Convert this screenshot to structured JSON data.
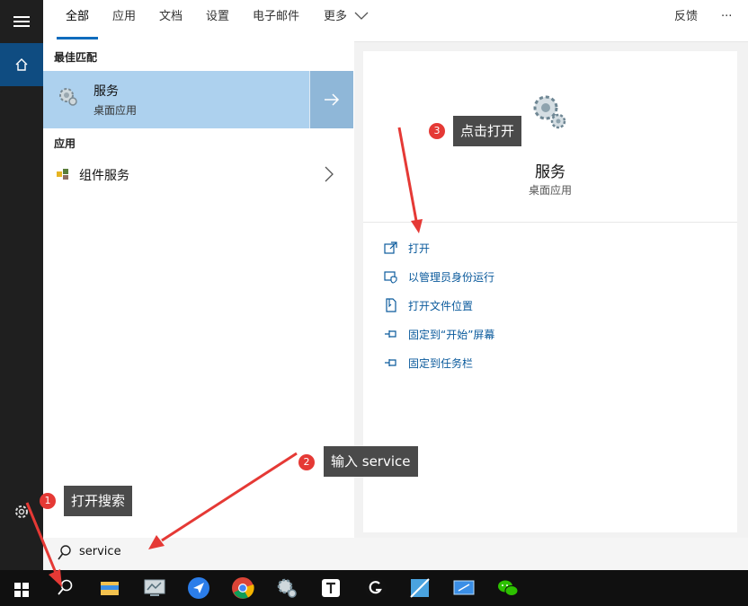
{
  "tabs": [
    "全部",
    "应用",
    "文档",
    "设置",
    "电子邮件",
    "更多"
  ],
  "feedback": "反馈",
  "more_menu": "···",
  "best_match": {
    "label": "最佳匹配",
    "title": "服务",
    "subtitle": "桌面应用"
  },
  "apps": {
    "label": "应用",
    "item": "组件服务"
  },
  "detail": {
    "title": "服务",
    "subtitle": "桌面应用",
    "actions": [
      "打开",
      "以管理员身份运行",
      "打开文件位置",
      "固定到“开始”屏幕",
      "固定到任务栏"
    ]
  },
  "search": {
    "value": "service"
  },
  "callouts": {
    "c1": {
      "num": "1",
      "text": "打开搜索"
    },
    "c2": {
      "num": "2",
      "text": "输入 service"
    },
    "c3": {
      "num": "3",
      "text": "点击打开"
    }
  },
  "colors": {
    "accent": "#0f6cbd",
    "best_bg": "#add1ee",
    "action_text": "#0a5a9c",
    "arrow": "#e53935"
  },
  "taskbar_icons": [
    "windows-icon",
    "search-icon",
    "file-explorer-icon",
    "monitor-app-icon",
    "feishu-icon",
    "chrome-icon",
    "settings-gear-icon",
    "typora-icon",
    "logi-icon",
    "app-icon-blue",
    "screen-app-icon",
    "wechat-icon"
  ]
}
